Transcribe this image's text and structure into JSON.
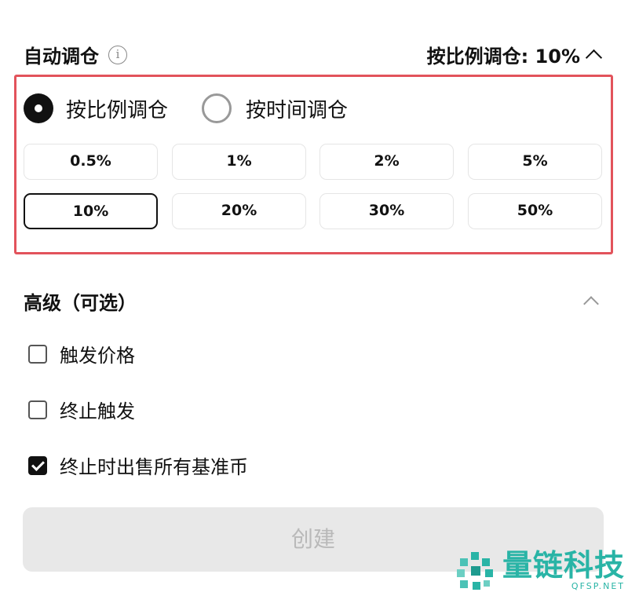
{
  "auto_rebalance": {
    "title": "自动调仓",
    "info_icon": "info-icon",
    "summary": "按比例调仓: 10%",
    "collapse_icon": "chevron-up-icon"
  },
  "mode": {
    "options": [
      {
        "label": "按比例调仓",
        "selected": true
      },
      {
        "label": "按时间调仓",
        "selected": false
      }
    ]
  },
  "ratios": {
    "selected": "10%",
    "values": [
      "0.5%",
      "1%",
      "2%",
      "5%",
      "10%",
      "20%",
      "30%",
      "50%"
    ]
  },
  "advanced": {
    "title": "高级（可选）",
    "collapse_icon": "chevron-up-icon",
    "options": [
      {
        "label": "触发价格",
        "checked": false
      },
      {
        "label": "终止触发",
        "checked": false
      },
      {
        "label": "终止时出售所有基准币",
        "checked": true
      }
    ]
  },
  "create_button": {
    "label": "创建"
  },
  "watermark": {
    "name": "量链科技",
    "sub": "QFSP.NET"
  },
  "colors": {
    "highlight_border": "#e2535b",
    "watermark": "#29b4a6",
    "button_disabled": "#e8e8e8"
  }
}
